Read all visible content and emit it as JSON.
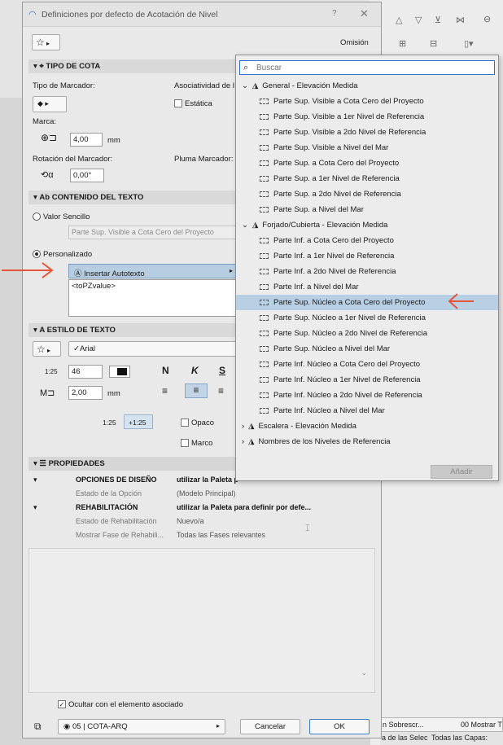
{
  "dialog": {
    "title": "Definiciones por defecto de Acotación de Nivel",
    "help": "?",
    "close": "✕",
    "omision": "Omisión"
  },
  "tipo_cota": {
    "header": "TIPO DE COTA",
    "tipo_marcador": "Tipo de Marcador:",
    "asociatividad": "Asociatividad de l",
    "estatica": "Estática",
    "marca": "Marca:",
    "marca_value": "4,00",
    "marca_unit": "mm",
    "rotacion": "Rotación del Marcador:",
    "rotacion_value": "0,00°",
    "pluma": "Pluma Marcador:"
  },
  "contenido": {
    "header": "CONTENIDO DEL TEXTO",
    "valor_sencillo": "Valor Sencillo",
    "valor_placeholder": "Parte Sup. Visible a Cota Cero del Proyecto",
    "personalizado": "Personalizado",
    "insertar": "Insertar Autotexto",
    "text_value": "<toPZvalue>"
  },
  "estilo": {
    "header": "ESTILO DE TEXTO",
    "font": "Arial",
    "size": "46",
    "size_label": "1:25",
    "height": "2,00",
    "height_unit": "mm",
    "bold": "N",
    "italic": "K",
    "underline": "S",
    "scale_a": "1:25",
    "scale_b": "+1:25",
    "opaco": "Opaco",
    "marco": "Marco"
  },
  "propiedades": {
    "header": "PROPIEDADES",
    "rows": [
      {
        "name": "OPCIONES DE DISEÑO",
        "value": "utilizar la Paleta p",
        "bold": true
      },
      {
        "name": "Estado de la Opción",
        "value": "(Modelo Principal)",
        "bold": false
      },
      {
        "name": "REHABILITACIÓN",
        "value": "utilizar la Paleta para definir por defe...",
        "bold": true
      },
      {
        "name": "Estado de Rehabilitación",
        "value": "Nuevo/a",
        "bold": false
      },
      {
        "name": "Mostrar Fase de Rehabili...",
        "value": "Todas las Fases relevantes",
        "bold": false
      }
    ]
  },
  "footer": {
    "ocultar": "Ocultar con el elemento asociado",
    "layer": "05 | COTA-ARQ",
    "cancel": "Cancelar",
    "ok": "OK"
  },
  "popup": {
    "search_placeholder": "Buscar",
    "add": "Añadir",
    "groups": [
      {
        "label": "General - Elevación Medida",
        "items": [
          "Parte Sup. Visible a Cota Cero del Proyecto",
          "Parte Sup. Visible a 1er Nivel de Referencia",
          "Parte Sup. Visible a 2do Nivel de Referencia",
          "Parte Sup. Visible a Nivel del Mar",
          "Parte Sup. a Cota Cero del Proyecto",
          "Parte Sup. a 1er Nivel de Referencia",
          "Parte Sup. a 2do Nivel de Referencia",
          "Parte Sup. a Nivel del Mar"
        ]
      },
      {
        "label": "Forjado/Cubierta - Elevación Medida",
        "items": [
          "Parte Inf. a Cota Cero del Proyecto",
          "Parte Inf. a 1er Nivel de Referencia",
          "Parte Inf. a 2do Nivel de Referencia",
          "Parte Inf. a Nivel del Mar",
          "Parte Sup. Núcleo a Cota Cero del Proyecto",
          "Parte Sup. Núcleo a 1er Nivel de Referencia",
          "Parte Sup. Núcleo a 2do Nivel de Referencia",
          "Parte Sup. Núcleo a Nivel del Mar",
          "Parte Inf. Núcleo a Cota Cero del Proyecto",
          "Parte Inf. Núcleo a 1er Nivel de Referencia",
          "Parte Inf. Núcleo a 2do Nivel de Referencia",
          "Parte Inf. Núcleo a Nivel del Mar"
        ]
      },
      {
        "label": "Escalera - Elevación Medida",
        "items": []
      },
      {
        "label": "Nombres de los Niveles de Referencia",
        "items": []
      }
    ],
    "selected": "Parte Sup. Núcleo a Cota Cero del Proyecto"
  },
  "background": {
    "right_a": "n Sobrescr...",
    "right_b": "00 Mostrar T",
    "right_c": "a de las Selec",
    "right_d": "Todas las Capas:"
  }
}
